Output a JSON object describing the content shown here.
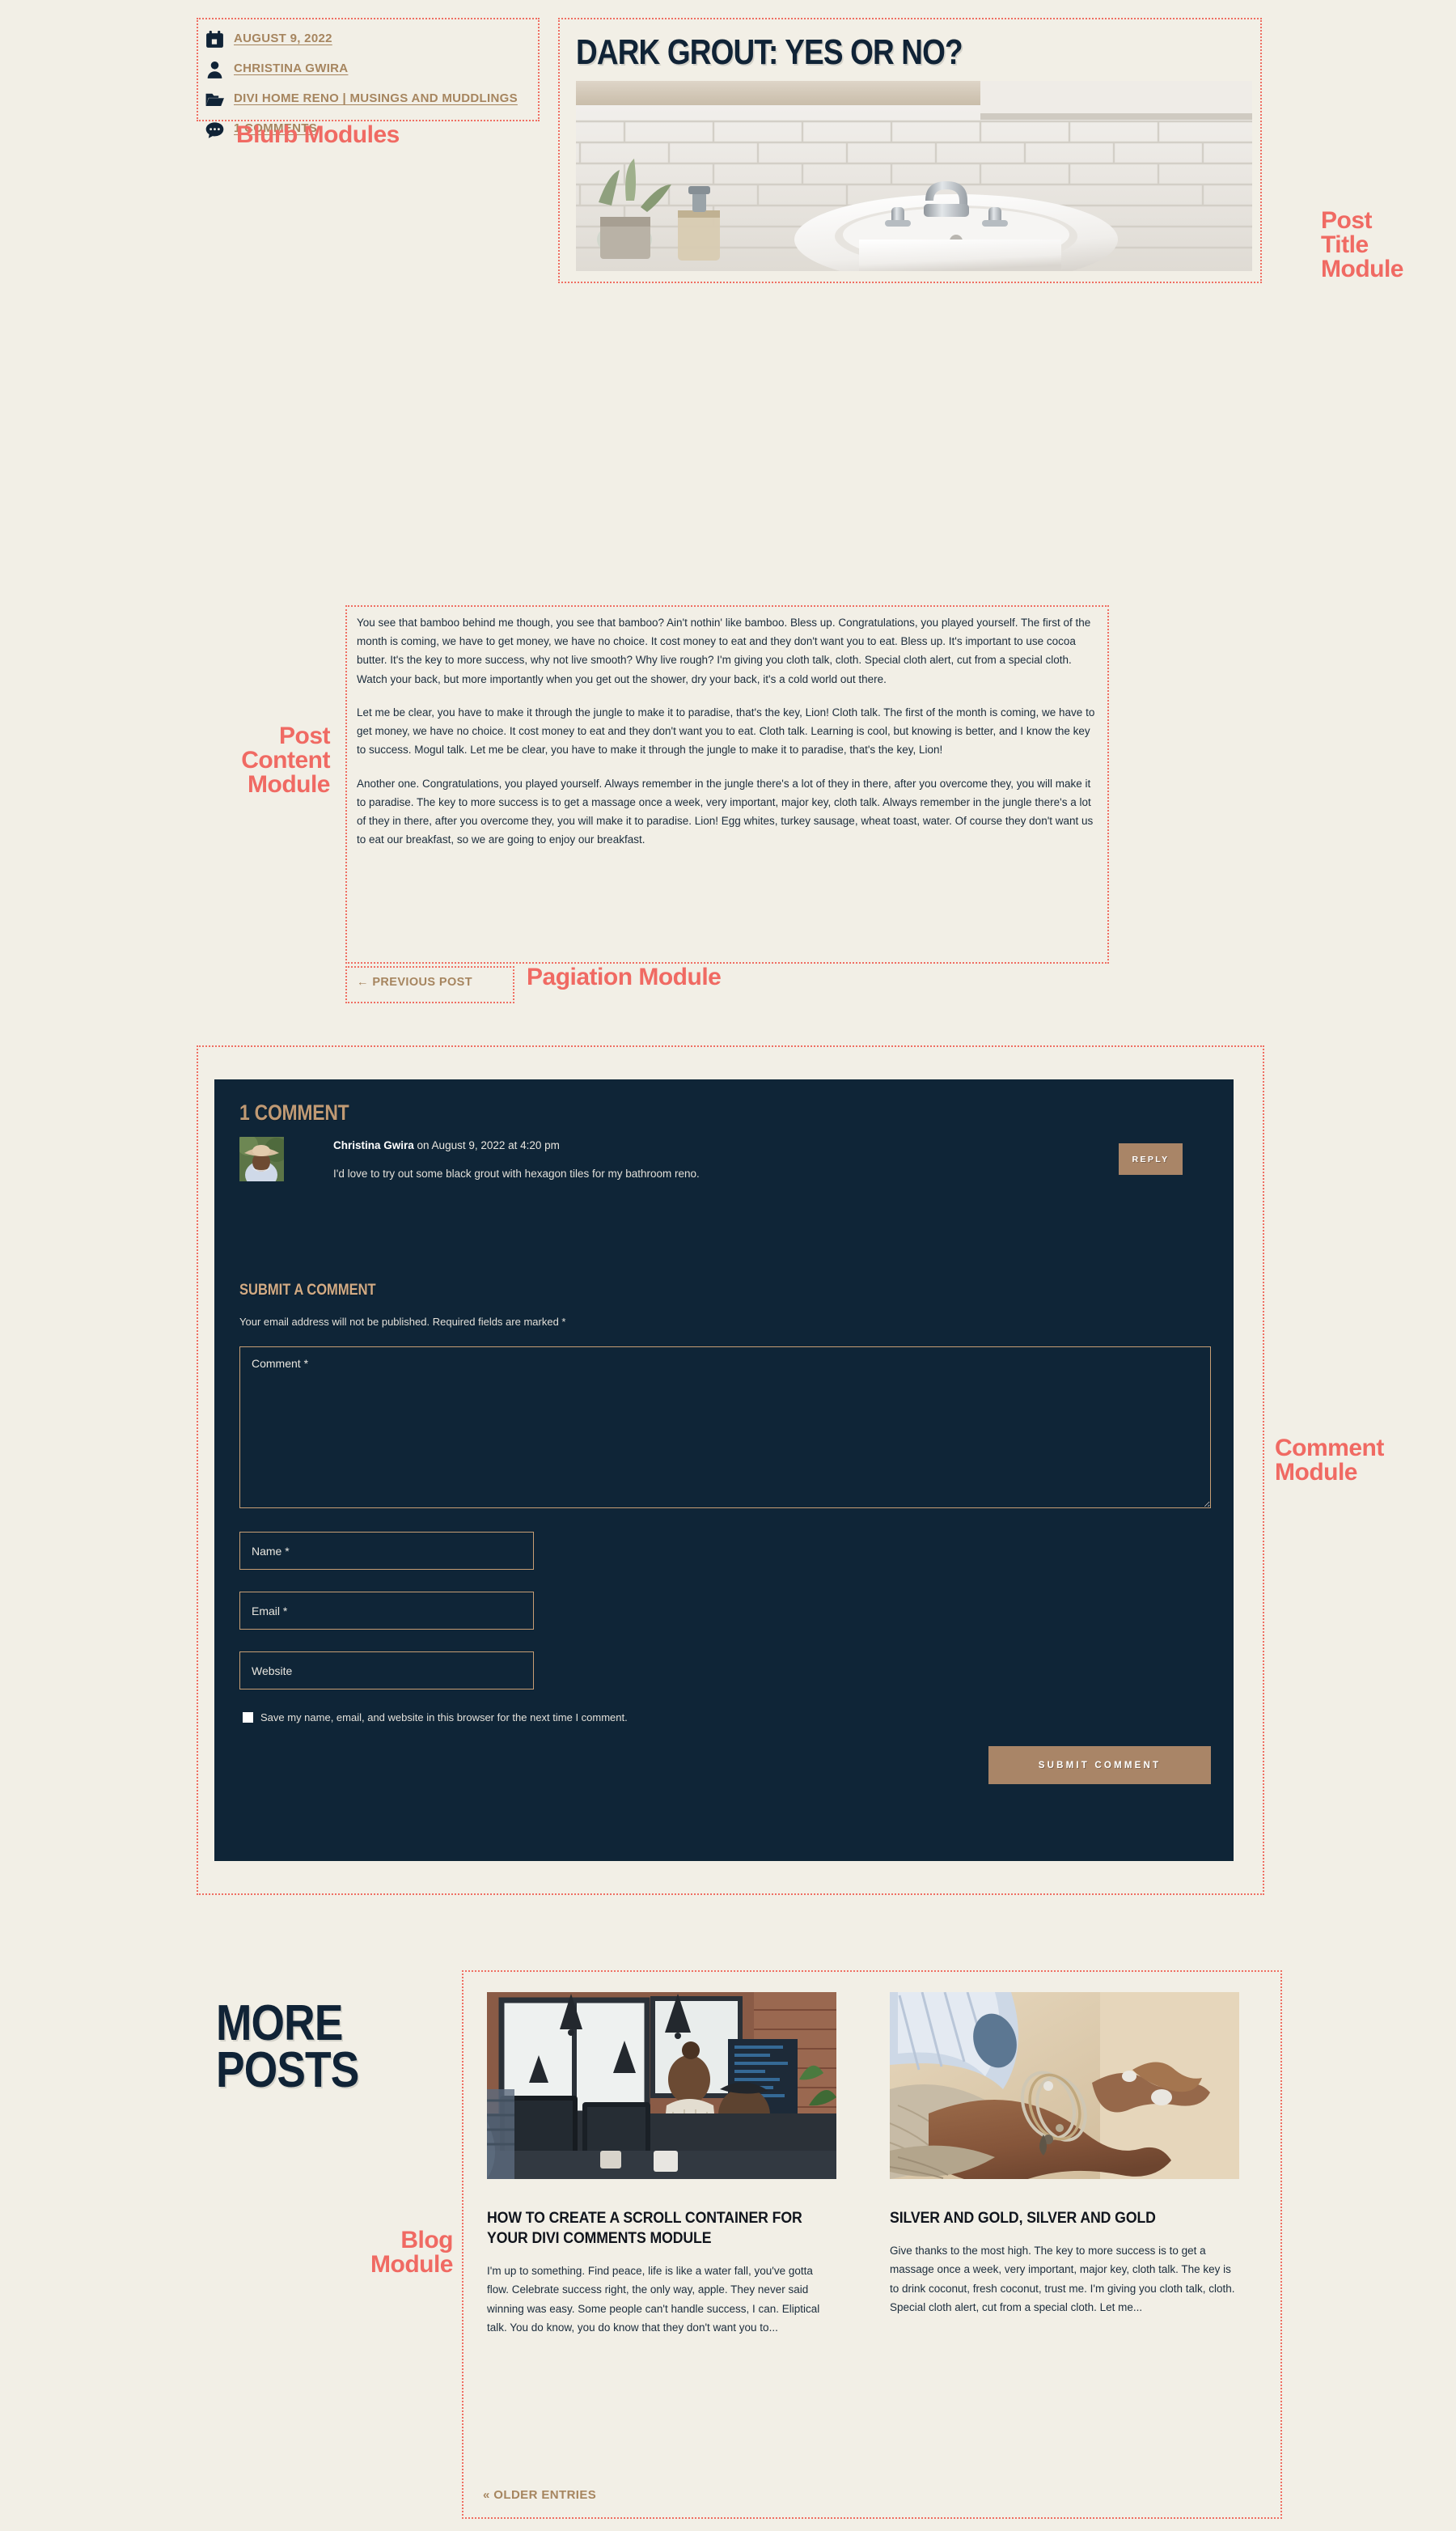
{
  "page": {
    "background_color": "#f2efe6",
    "accent_annotation_color": "#f06a63",
    "dark_panel_color": "#0f2537",
    "gold_color": "#a6855f",
    "button_color": "#a98567"
  },
  "annotations": {
    "blurb": "Blurb Modules",
    "post_title": "Post\nTitle\nModule",
    "post_content": "Post\nContent\nModule",
    "pagination": "Pagiation Module",
    "comment": "Comment\nModule",
    "blog": "Blog\nModule"
  },
  "blurbs": [
    {
      "icon": "calendar-icon",
      "label": "AUGUST 9, 2022"
    },
    {
      "icon": "person-icon",
      "label": "CHRISTINA GWIRA"
    },
    {
      "icon": "folder-icon",
      "label": "DIVI HOME RENO | MUSINGS AND MUDDLINGS"
    },
    {
      "icon": "comment-bubble-icon",
      "label": "1 COMMENTS"
    }
  ],
  "post": {
    "title": "DARK GROUT: YES OR NO?",
    "hero_image_alt": "bathroom-sink-white-subway-tile",
    "paragraphs": [
      "You see that bamboo behind me though, you see that bamboo? Ain't nothin' like bamboo. Bless up. Congratulations, you played yourself. The first of the month is coming, we have to get money, we have no choice. It cost money to eat and they don't want you to eat. Bless up. It's important to use cocoa butter. It's the key to more success, why not live smooth? Why live rough? I'm giving you cloth talk, cloth. Special cloth alert, cut from a special cloth. Watch your back, but more importantly when you get out the shower, dry your back, it's a cold world out there.",
      "Let me be clear, you have to make it through the jungle to make it to paradise, that's the key, Lion! Cloth talk. The first of the month is coming, we have to get money, we have no choice. It cost money to eat and they don't want you to eat. Cloth talk. Learning is cool, but knowing is better, and I know the key to success. Mogul talk. Let me be clear, you have to make it through the jungle to make it to paradise, that's the key, Lion!",
      "Another one. Congratulations, you played yourself. Always remember in the jungle there's a lot of they in there, after you overcome they, you will make it to paradise. The key to more success is to get a massage once a week, very important, major key, cloth talk. Always remember in the jungle there's a lot of they in there, after you overcome they, you will make it to paradise. Lion! Egg whites, turkey sausage, wheat toast, water. Of course they don't want us to eat our breakfast, so we are going to enjoy our breakfast."
    ]
  },
  "pagination": {
    "previous_label": "← PREVIOUS POST"
  },
  "comments": {
    "count_heading": "1 COMMENT",
    "items": [
      {
        "author": "Christina Gwira",
        "meta": " on August 9, 2022 at 4:20 pm",
        "body": "I'd love to try out some black grout with hexagon tiles for my bathroom reno.",
        "reply_label": "REPLY"
      }
    ],
    "form": {
      "heading": "SUBMIT A COMMENT",
      "note": "Your email address will not be published. Required fields are marked *",
      "comment_placeholder": "Comment *",
      "comment_value": "",
      "name_placeholder": "Name *",
      "name_value": "",
      "email_placeholder": "Email *",
      "email_value": "",
      "website_placeholder": "Website",
      "website_value": "",
      "save_label": "Save my name, email, and website in this browser for the next time I comment.",
      "submit_label": "SUBMIT COMMENT"
    }
  },
  "blog": {
    "heading": "MORE\nPOSTS",
    "older_entries_label": "« OLDER ENTRIES",
    "posts": [
      {
        "title": "HOW TO CREATE A SCROLL CONTAINER FOR YOUR DIVI COMMENTS MODULE",
        "excerpt": "I'm up to something. Find peace, life is like a water fall, you've gotta flow. Celebrate success right, the only way, apple. They never said winning was easy. Some people can't handle success, I can. Eliptical talk. You do know, you do know that they don't want you to...",
        "image_alt": "two-coworkers-at-desk-with-monitors"
      },
      {
        "title": "SILVER AND GOLD, SILVER AND GOLD",
        "excerpt": "Give thanks to the most high. The key to more success is to get a massage once a week, very important, major key, cloth talk. The key is to drink coconut, fresh coconut, trust me. I'm giving you cloth talk, cloth. Special cloth alert, cut from a special cloth. Let me...",
        "image_alt": "hands-with-silver-and-gold-bracelets"
      }
    ]
  }
}
